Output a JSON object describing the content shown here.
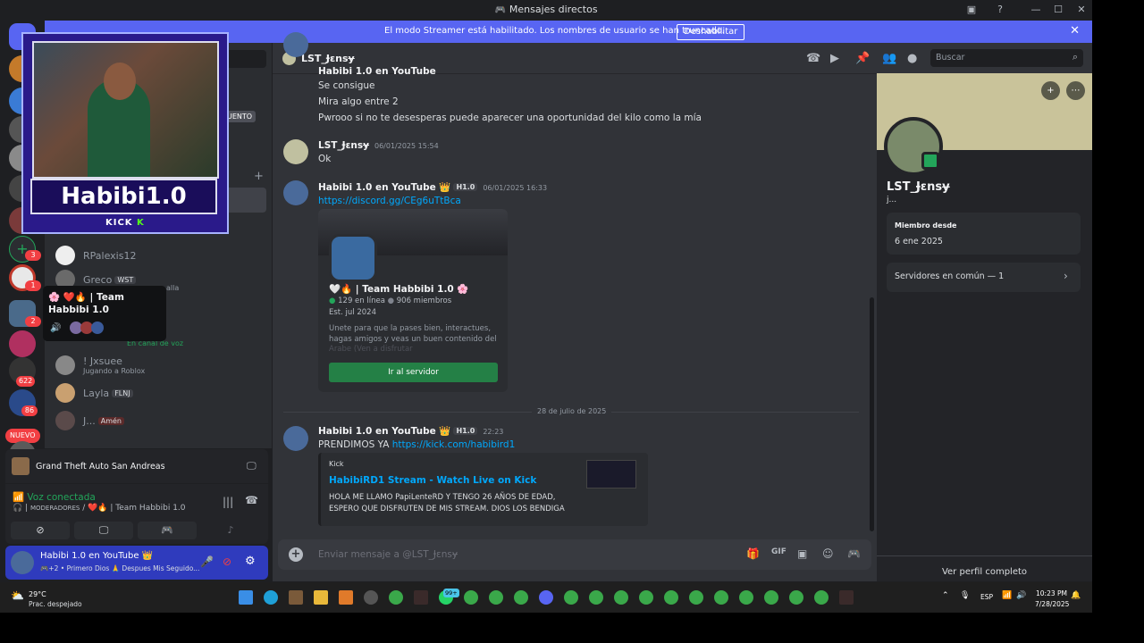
{
  "window": {
    "title": "Mensajes directos"
  },
  "banner": {
    "message": "El modo Streamer está habilitado. Los nombres de usuario se han truncado.",
    "button": "Deshabilitar",
    "close": "✕"
  },
  "colors": {
    "accent": "#5865f2",
    "background": "#313338",
    "sidebar": "#2b2d31",
    "online": "#23a55a",
    "link": "#00a8fc"
  },
  "server_badges": [
    "3",
    "1",
    "2",
    "622",
    "86",
    "NUEVO"
  ],
  "dm_list": {
    "friend_badge": "UENTO",
    "items": [
      {
        "name": "RPalexis12",
        "sub": "",
        "tag": ""
      },
      {
        "name": "Greco",
        "sub": "",
        "tag": "WST"
      },
      {
        "name": "! Jxsuee",
        "sub": "Jugando a Roblox",
        "tag": ""
      },
      {
        "name": "Layla",
        "sub": "",
        "tag": "FLNJ"
      },
      {
        "name": "J...",
        "sub": "",
        "tag": "Amén"
      }
    ],
    "partial_sub": "En canal de voz",
    "partial_text": "alla"
  },
  "webcam": {
    "name": "Habibi1.0",
    "platform": "KICK"
  },
  "voice_popup": {
    "title": "🌸 ❤️🔥 | Team Habbibi 1.0"
  },
  "activity": {
    "game": "Grand Theft Auto San Andreas"
  },
  "voice": {
    "status": "Voz conectada",
    "role": "MODERADORES",
    "channel": "/ ❤️🔥 | Team Habbibi 1.0"
  },
  "user_panel": {
    "name": "Habibi 1.0 en YouTube 👑",
    "status": "🎮+2 • Primero Dios 🙏 Despues Mis Seguido..."
  },
  "chat_header": {
    "name": "LST_Ɉɛnsɏ",
    "search_placeholder": "Buscar"
  },
  "messages": {
    "top_author": "Habibi 1.0 en YouTube",
    "top_lines": [
      "Se consigue",
      "Mira algo entre 2",
      "Pwrooo si no te desesperas puede aparecer una oportunidad del kilo como la mía"
    ],
    "m2_author": "LST_Ɉɛnsɏ",
    "m2_time": "06/01/2025 15:54",
    "m2_text": "Ok",
    "m3_author": "Habibi 1.0 en YouTube 👑",
    "m3_tag": "H1.0",
    "m3_time": "06/01/2025 16:33",
    "m3_link": "https://discord.gg/CEg6uTtBca",
    "divider": "28 de julio de 2025",
    "m4_author": "Habibi 1.0 en YouTube 👑",
    "m4_tag": "H1.0",
    "m4_time": "22:23",
    "m4_text": "PRENDIMOS YA",
    "m4_link": "https://kick.com/habibird1"
  },
  "invite": {
    "server_name": "🤍🔥 | Team Habbibi 1.0 🌸",
    "online": "129 en línea",
    "members": "906 miembros",
    "established": "Est. jul 2024",
    "description": "Unete para que la pases bien, interactues, hagas amigos y veas un buen contenido del",
    "description_faded": "Arabe (Ven a disfrutar",
    "button": "Ir al servidor"
  },
  "embed": {
    "provider": "Kick",
    "title": "HabibiRD1 Stream - Watch Live on Kick",
    "line1": "HOLA ME LLAMO PapiLenteRD Y TENGO 26 AÑOS DE EDAD,",
    "line2": "ESPERO QUE DISFRUTEN DE MIS STREAM. DIOS LOS BENDIGA"
  },
  "composer": {
    "placeholder": "Enviar mensaje a @LST_Ɉɛnsɏ"
  },
  "profile": {
    "name": "LST_Ɉɛnsɏ",
    "tagline": "j...",
    "member_since_label": "Miembro desde",
    "member_since": "6 ene 2025",
    "mutual": "Servidores en común — 1",
    "full_profile": "Ver perfil completo"
  },
  "taskbar": {
    "weather_temp": "29°C",
    "weather_desc": "Prac. despejado",
    "lang": "ESP",
    "time": "10:23 PM",
    "date": "7/28/2025",
    "badge_count": "99+"
  }
}
